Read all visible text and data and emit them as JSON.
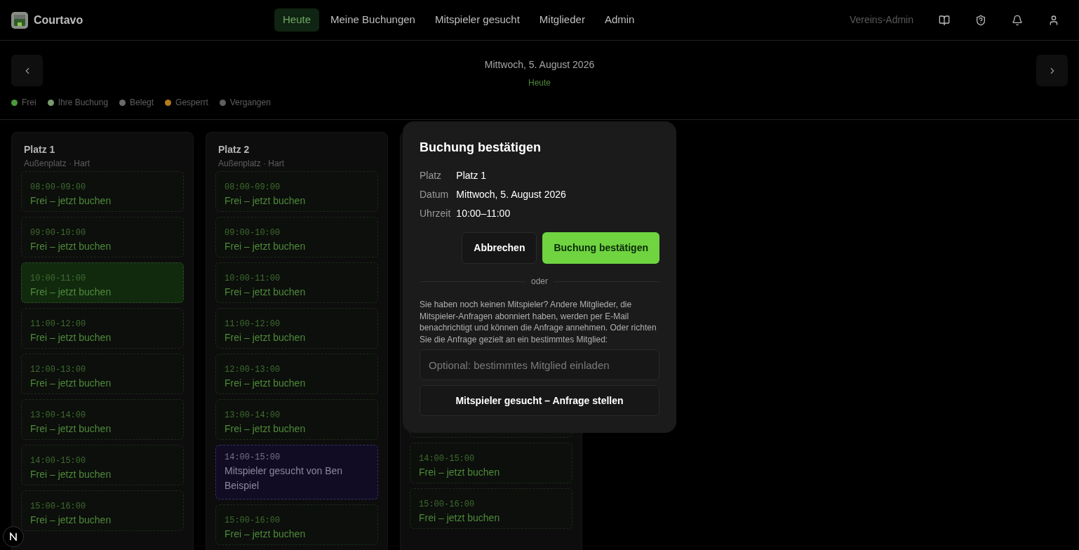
{
  "app": {
    "name": "Courtavo"
  },
  "nav": [
    {
      "label": "Heute",
      "selected": true
    },
    {
      "label": "Meine Buchungen",
      "selected": false
    },
    {
      "label": "Mitspieler gesucht",
      "selected": false
    },
    {
      "label": "Mitglieder",
      "selected": false
    },
    {
      "label": "Admin",
      "selected": false
    }
  ],
  "user_role": "Vereins-Admin",
  "date_bar": {
    "date": "Mittwoch, 5. August 2026",
    "today_label": "Heute"
  },
  "legend": [
    {
      "label": "Frei",
      "color": "#4a9a3a"
    },
    {
      "label": "Ihre Buchung",
      "color": "#7a9a6e"
    },
    {
      "label": "Belegt",
      "color": "#6b6b6b"
    },
    {
      "label": "Gesperrt",
      "color": "#b7791f"
    },
    {
      "label": "Vergangen",
      "color": "#5f5f5f"
    }
  ],
  "courts": [
    {
      "name": "Platz 1",
      "subtitle": "Außenplatz · Hart",
      "slots": [
        {
          "kind": "free",
          "time": "08:00-09:00",
          "label": "Frei – jetzt buchen",
          "selected": false
        },
        {
          "kind": "free",
          "time": "09:00-10:00",
          "label": "Frei – jetzt buchen",
          "selected": false
        },
        {
          "kind": "free",
          "time": "10:00-11:00",
          "label": "Frei – jetzt buchen",
          "selected": true
        },
        {
          "kind": "free",
          "time": "11:00-12:00",
          "label": "Frei – jetzt buchen",
          "selected": false
        },
        {
          "kind": "free",
          "time": "12:00-13:00",
          "label": "Frei – jetzt buchen",
          "selected": false
        },
        {
          "kind": "free",
          "time": "13:00-14:00",
          "label": "Frei – jetzt buchen",
          "selected": false
        },
        {
          "kind": "free",
          "time": "14:00-15:00",
          "label": "Frei – jetzt buchen",
          "selected": false
        },
        {
          "kind": "free",
          "time": "15:00-16:00",
          "label": "Frei – jetzt buchen",
          "selected": false
        }
      ]
    },
    {
      "name": "Platz 2",
      "subtitle": "Außenplatz · Hart",
      "slots": [
        {
          "kind": "free",
          "time": "08:00-09:00",
          "label": "Frei – jetzt buchen",
          "selected": false
        },
        {
          "kind": "free",
          "time": "09:00-10:00",
          "label": "Frei – jetzt buchen",
          "selected": false
        },
        {
          "kind": "free",
          "time": "10:00-11:00",
          "label": "Frei – jetzt buchen",
          "selected": false
        },
        {
          "kind": "free",
          "time": "11:00-12:00",
          "label": "Frei – jetzt buchen",
          "selected": false
        },
        {
          "kind": "free",
          "time": "12:00-13:00",
          "label": "Frei – jetzt buchen",
          "selected": false
        },
        {
          "kind": "free",
          "time": "13:00-14:00",
          "label": "Frei – jetzt buchen",
          "selected": false
        },
        {
          "kind": "request",
          "time": "14:00-15:00",
          "label": "Mitspieler gesucht von Ben Beispiel"
        },
        {
          "kind": "free",
          "time": "15:00-16:00",
          "label": "Frei – jetzt buchen",
          "selected": false
        }
      ]
    },
    {
      "slots": [
        {
          "kind": "free",
          "time": "14:00-15:00",
          "label": "Frei – jetzt buchen",
          "selected": false
        },
        {
          "kind": "free",
          "time": "15:00-16:00",
          "label": "Frei – jetzt buchen",
          "selected": false
        }
      ]
    }
  ],
  "dialog": {
    "title": "Buchung bestätigen",
    "details": [
      {
        "label": "Platz",
        "value": "Platz 1"
      },
      {
        "label": "Datum",
        "value": "Mittwoch, 5. August 2026"
      },
      {
        "label": "Uhrzeit",
        "value": "10:00–11:00"
      }
    ],
    "cancel": "Abbrechen",
    "confirm": "Buchung bestätigen",
    "divider": "oder",
    "info": "Sie haben noch keinen Mitspieler? Andere Mitglieder, die Mitspieler-Anfragen abonniert haben, werden per E-Mail benachrichtigt und können die Anfrage annehmen. Oder richten Sie die Anfrage gezielt an ein bestimmtes Mitglied:",
    "invite": {
      "placeholder": "Optional: bestimmtes Mitglied einladen"
    },
    "request_button": "Mitspieler gesucht – Anfrage stellen"
  }
}
